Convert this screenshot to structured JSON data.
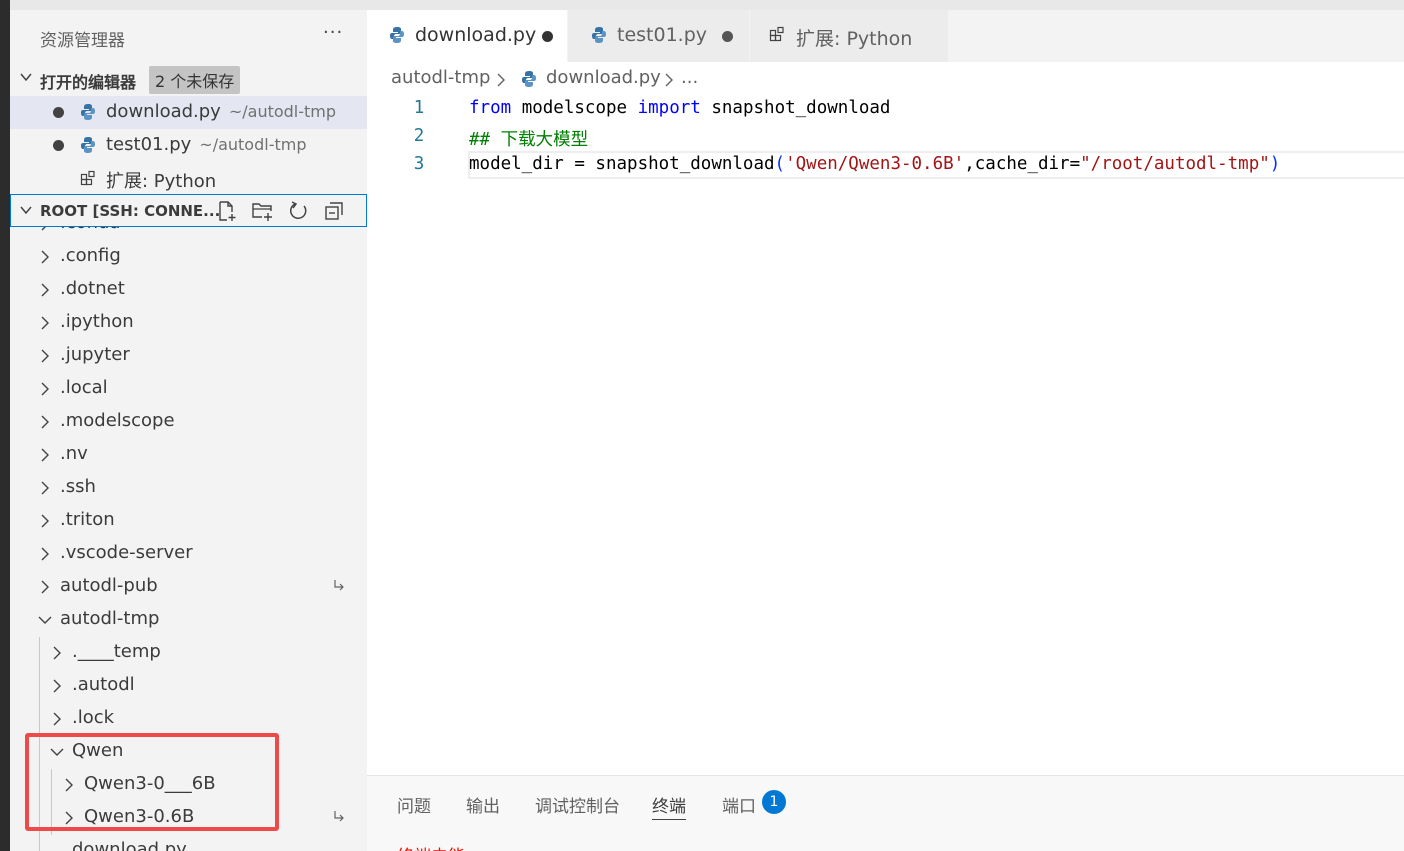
{
  "sidebar": {
    "title": "资源管理器",
    "more": "···",
    "open_editors": {
      "header": "打开的编辑器",
      "badge": "2 个未保存",
      "items": [
        {
          "name": "download.py",
          "path": "~/autodl-tmp",
          "dirty": true,
          "icon": "python-icon"
        },
        {
          "name": "test01.py",
          "path": "~/autodl-tmp",
          "dirty": true,
          "icon": "python-icon"
        },
        {
          "name": "扩展: Python",
          "path": "",
          "dirty": false,
          "icon": "extensions-icon"
        }
      ]
    },
    "root": {
      "header": "ROOT [SSH: CONNE...",
      "actions": [
        "new-file-icon",
        "new-folder-icon",
        "refresh-icon",
        "collapse-all-icon"
      ]
    },
    "tree": [
      {
        "name": ".conda",
        "depth": 0,
        "expanded": false
      },
      {
        "name": ".config",
        "depth": 0,
        "expanded": false
      },
      {
        "name": ".dotnet",
        "depth": 0,
        "expanded": false
      },
      {
        "name": ".ipython",
        "depth": 0,
        "expanded": false
      },
      {
        "name": ".jupyter",
        "depth": 0,
        "expanded": false
      },
      {
        "name": ".local",
        "depth": 0,
        "expanded": false
      },
      {
        "name": ".modelscope",
        "depth": 0,
        "expanded": false
      },
      {
        "name": ".nv",
        "depth": 0,
        "expanded": false
      },
      {
        "name": ".ssh",
        "depth": 0,
        "expanded": false
      },
      {
        "name": ".triton",
        "depth": 0,
        "expanded": false
      },
      {
        "name": ".vscode-server",
        "depth": 0,
        "expanded": false
      },
      {
        "name": "autodl-pub",
        "depth": 0,
        "expanded": false,
        "symlink": true
      },
      {
        "name": "autodl-tmp",
        "depth": 0,
        "expanded": true
      },
      {
        "name": ".____temp",
        "depth": 1,
        "expanded": false
      },
      {
        "name": ".autodl",
        "depth": 1,
        "expanded": false
      },
      {
        "name": ".lock",
        "depth": 1,
        "expanded": false
      },
      {
        "name": "Qwen",
        "depth": 1,
        "expanded": true
      },
      {
        "name": "Qwen3-0___6B",
        "depth": 2,
        "expanded": false
      },
      {
        "name": "Qwen3-0.6B",
        "depth": 2,
        "expanded": false,
        "symlink": true
      },
      {
        "name": "download.py",
        "depth": 1,
        "expanded": false
      }
    ]
  },
  "tabs": [
    {
      "label": "download.py",
      "active": true,
      "dirty": true,
      "icon": "python-icon"
    },
    {
      "label": "test01.py",
      "active": false,
      "dirty": true,
      "icon": "python-icon"
    },
    {
      "label": "扩展: Python",
      "active": false,
      "dirty": false,
      "icon": "extensions-icon"
    }
  ],
  "breadcrumb": {
    "folder": "autodl-tmp",
    "file": "download.py",
    "more": "..."
  },
  "editor": {
    "lines": [
      {
        "number": "1",
        "tokens": [
          {
            "t": "from",
            "c": "kw"
          },
          {
            "t": " modelscope ",
            "c": "plain"
          },
          {
            "t": "import",
            "c": "kw"
          },
          {
            "t": " snapshot_download",
            "c": "plain"
          }
        ]
      },
      {
        "number": "2",
        "tokens": [
          {
            "t": "## 下载大模型",
            "c": "cm"
          }
        ]
      },
      {
        "number": "3",
        "tokens": [
          {
            "t": "model_dir = snapshot_download",
            "c": "plain"
          },
          {
            "t": "(",
            "c": "paren"
          },
          {
            "t": "'Qwen/Qwen3-0.6B'",
            "c": "str"
          },
          {
            "t": ",cache_dir=",
            "c": "plain"
          },
          {
            "t": "\"/root/autodl-tmp\"",
            "c": "str"
          },
          {
            "t": ")",
            "c": "paren"
          }
        ]
      }
    ]
  },
  "panel": {
    "tabs": [
      "问题",
      "输出",
      "调试控制台",
      "终端",
      "端口"
    ],
    "active_tab": "终端",
    "ports_badge": "1",
    "status_partial": "终端未能…"
  },
  "colors": {
    "accent": "#0078d4",
    "highlight_box": "#ef4a4a",
    "keyword": "#0000ff",
    "comment": "#008000",
    "string": "#a31515"
  }
}
